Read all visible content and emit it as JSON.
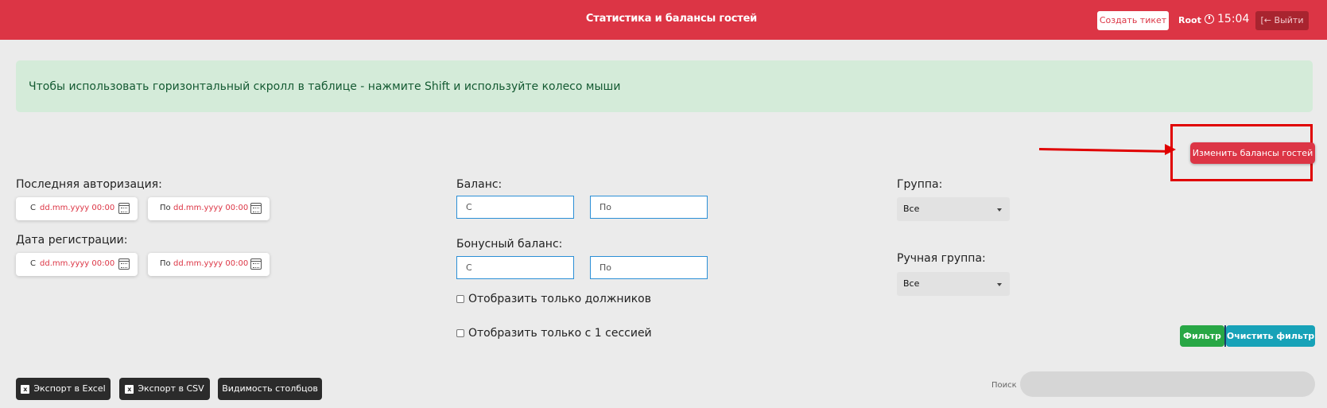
{
  "header": {
    "title": "Статистика и балансы гостей",
    "create_ticket": "Создать тикет",
    "user": "Root",
    "time": "15:04",
    "logout": "Выйти"
  },
  "alert": {
    "text": "Чтобы использовать горизонтальный скролл в таблице - нажмите Shift и используйте колесо мыши"
  },
  "actions": {
    "change_balances": "Изменить балансы гостей"
  },
  "filters": {
    "last_auth_label": "Последняя авторизация:",
    "reg_date_label": "Дата регистрации:",
    "from_prefix": "С",
    "to_prefix": "По",
    "date_placeholder": "dd.mm.yyyy 00:00",
    "balance_label": "Баланс:",
    "bonus_balance_label": "Бонусный баланс:",
    "from_placeholder": "С",
    "to_placeholder": "По",
    "debtors_only": "Отобразить только должников",
    "one_session_only": "Отобразить только с 1 сессией",
    "group_label": "Группа:",
    "group_value": "Все",
    "manual_group_label": "Ручная группа:",
    "manual_group_value": "Все",
    "filter_button": "Фильтр",
    "clear_filter_button": "Очистить фильтр"
  },
  "bottom": {
    "export_excel": "Экспорт в Excel",
    "export_csv": "Экспорт в CSV",
    "columns_visibility": "Видимость столбцов",
    "search_label": "Поиск"
  },
  "colors": {
    "brand_red": "#dc3545",
    "success_green": "#28a745",
    "info_teal": "#17a2b8",
    "annotation_red": "#e00000"
  }
}
